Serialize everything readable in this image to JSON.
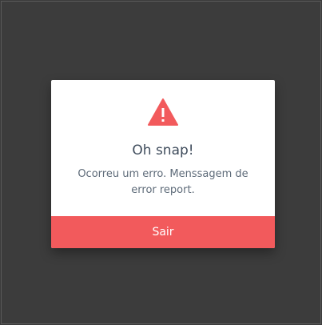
{
  "dialog": {
    "icon": "warning-triangle-icon",
    "title": "Oh snap!",
    "message": "Ocorreu um erro. Menssagem de error report.",
    "button_label": "Sair",
    "accent_color": "#f25a5c",
    "overlay_color": "#3b3b3b"
  }
}
